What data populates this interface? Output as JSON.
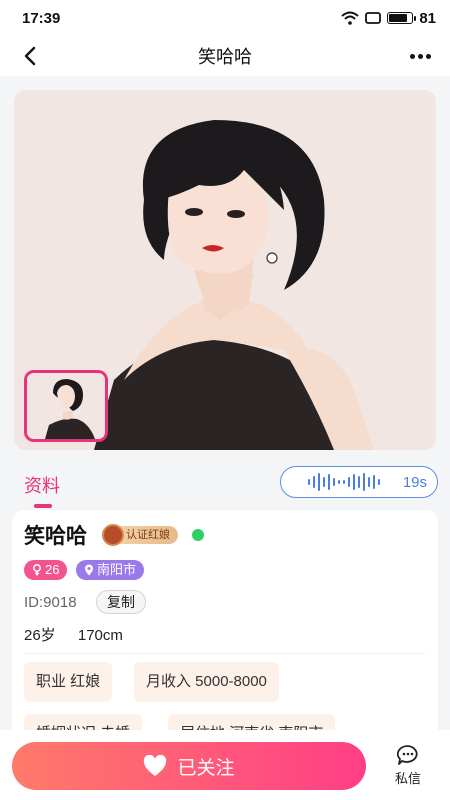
{
  "status_bar": {
    "time": "17:39",
    "battery": "81",
    "battery_level": 0.81
  },
  "nav": {
    "title": "笑哈哈",
    "back_icon": "chevron-left-icon",
    "more_icon": "more-dots-icon"
  },
  "photo": {
    "description_icon": "portrait-image"
  },
  "tabs": {
    "profile_label": "资料"
  },
  "voice": {
    "duration": "19s",
    "icon": "sound-wave-icon"
  },
  "profile": {
    "name": "笑哈哈",
    "cert_label": "认证红娘",
    "age": "26",
    "city": "南阳市",
    "id_text": "ID:9018",
    "copy_label": "复制",
    "age_text": "26岁",
    "height_text": "170cm",
    "chips": [
      "职业 红娘",
      "月收入 5000-8000",
      "婚姻状况 未婚",
      "居住地 河南省 南阳市"
    ]
  },
  "bottom": {
    "follow_label": "已关注",
    "dm_label": "私信"
  },
  "colors": {
    "accent": "#e8327a",
    "voice_blue": "#4a7fe0",
    "online": "#2fcf63"
  }
}
